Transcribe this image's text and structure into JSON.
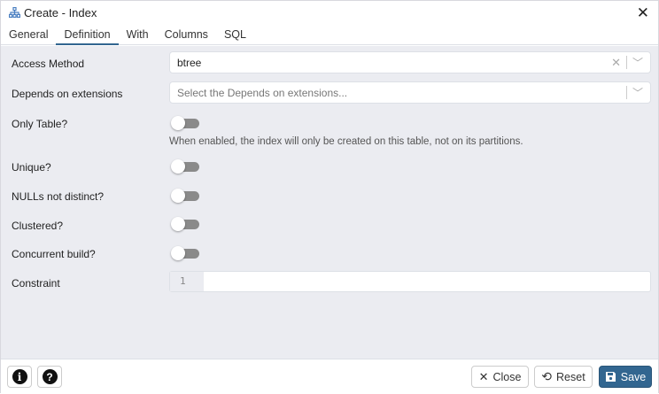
{
  "title": "Create - Index",
  "tabs": [
    "General",
    "Definition",
    "With",
    "Columns",
    "SQL"
  ],
  "active_tab": "Definition",
  "fields": {
    "access_method": {
      "label": "Access Method",
      "value": "btree"
    },
    "depends": {
      "label": "Depends on extensions",
      "placeholder": "Select the Depends on extensions..."
    },
    "only_table": {
      "label": "Only Table?",
      "value": false,
      "help": "When enabled, the index will only be created on this table, not on its partitions."
    },
    "unique": {
      "label": "Unique?",
      "value": false
    },
    "nulls_not_distinct": {
      "label": "NULLs not distinct?",
      "value": false
    },
    "clustered": {
      "label": "Clustered?",
      "value": false
    },
    "concurrent_build": {
      "label": "Concurrent build?",
      "value": false
    },
    "constraint": {
      "label": "Constraint",
      "line_number": "1",
      "value": ""
    }
  },
  "footer": {
    "close": "Close",
    "reset": "Reset",
    "save": "Save"
  },
  "colors": {
    "primary": "#326690",
    "body_bg": "#ebecf1"
  }
}
